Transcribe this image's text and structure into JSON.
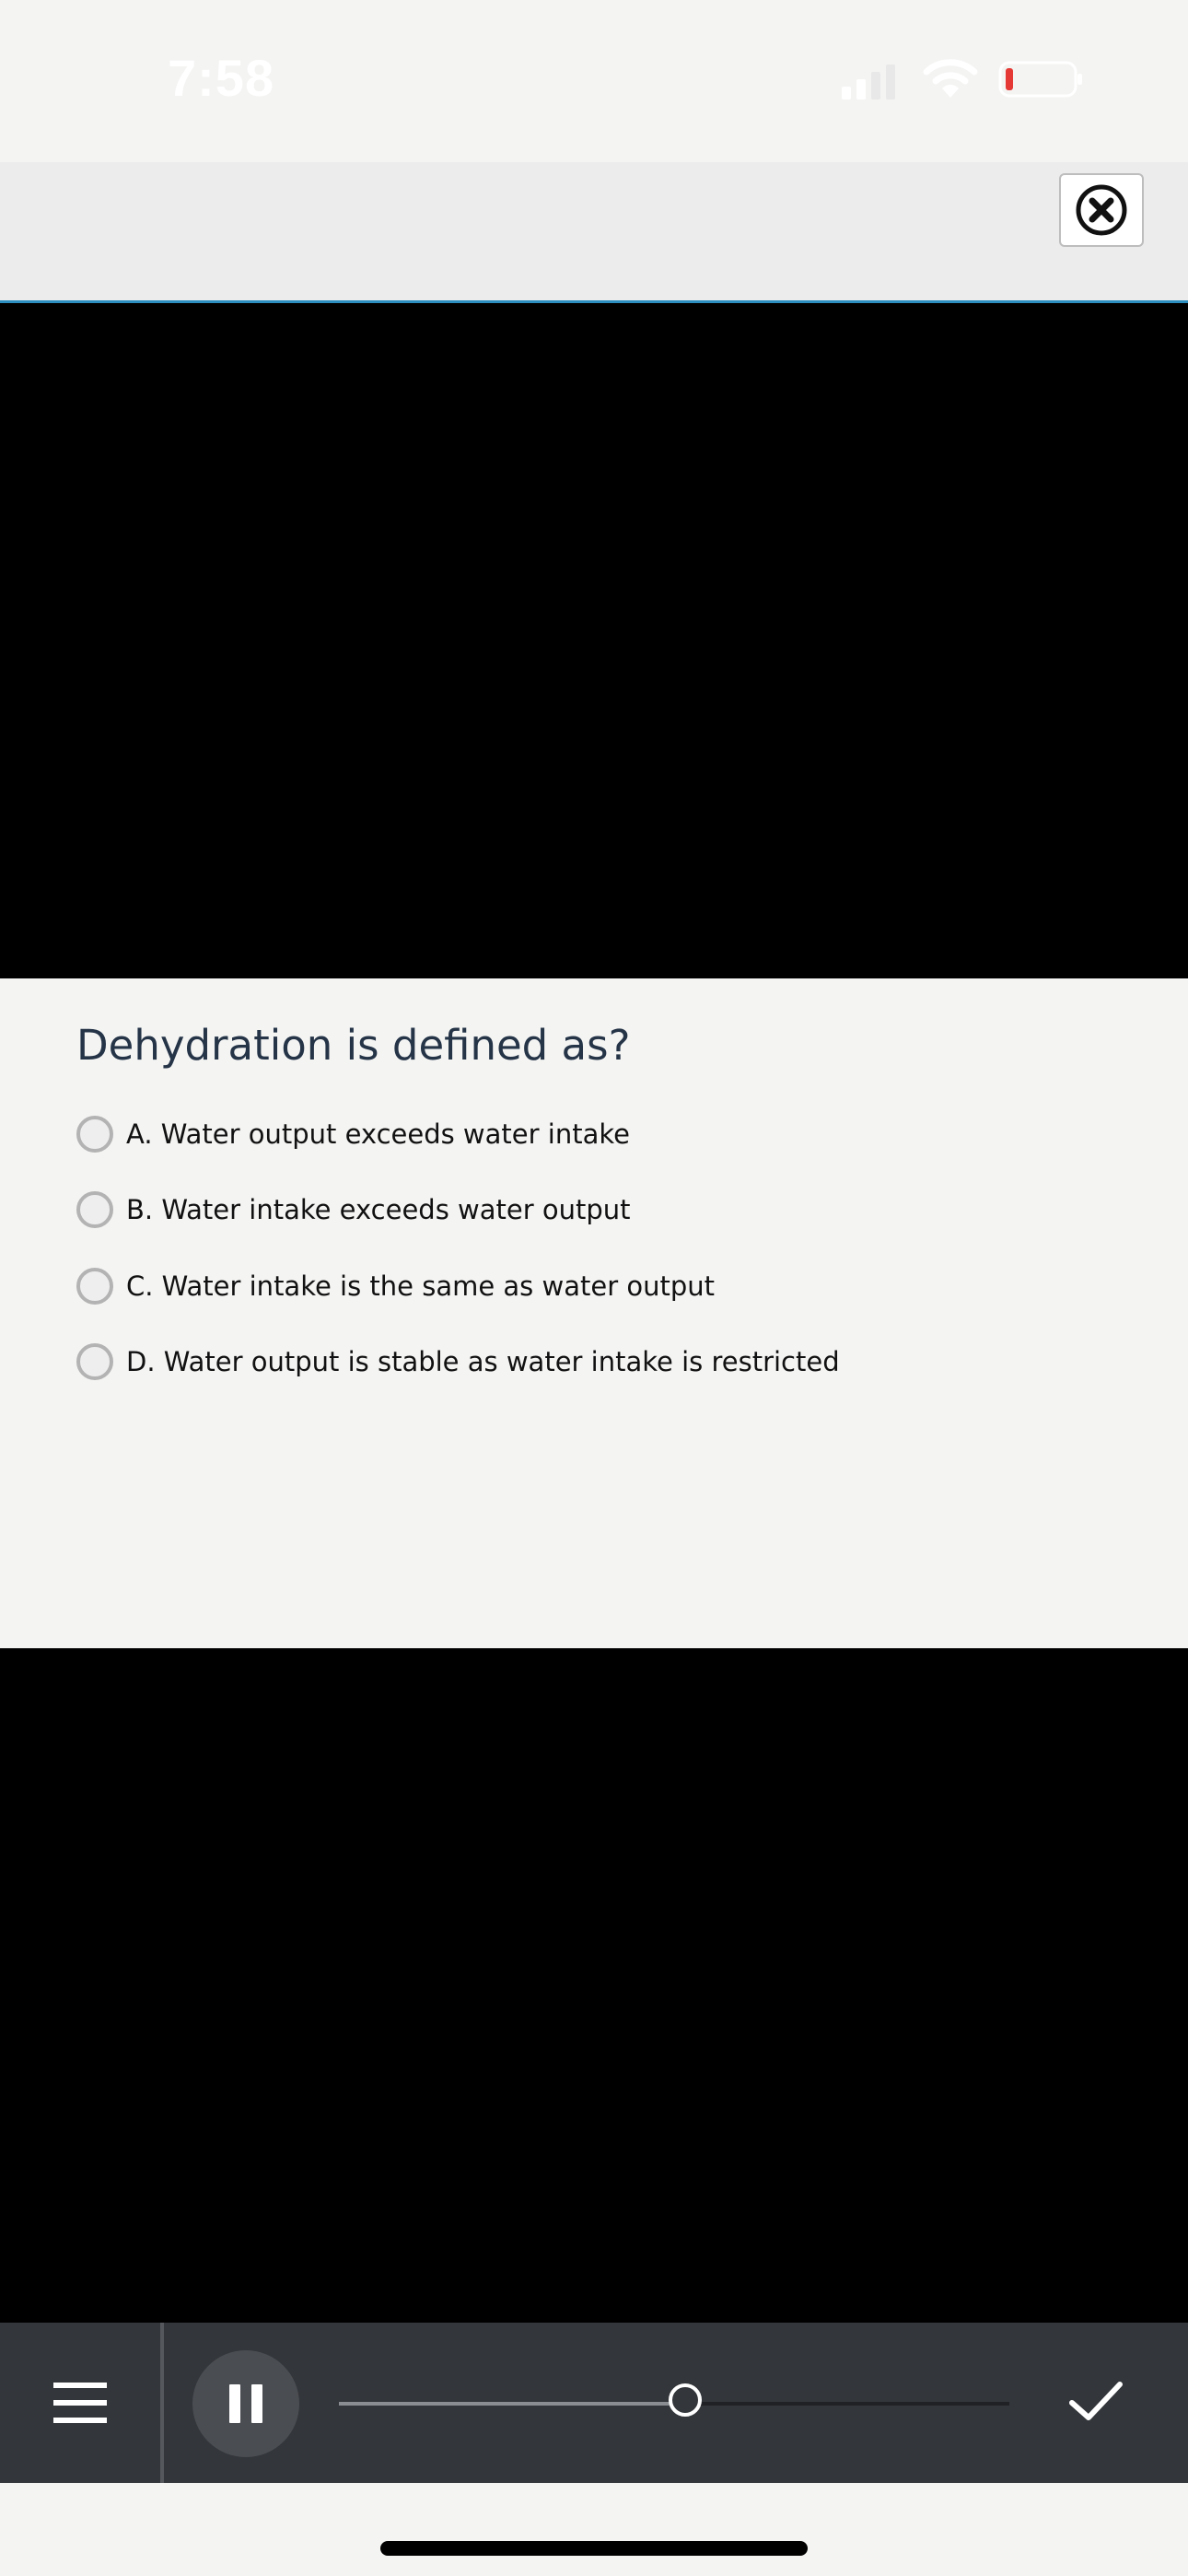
{
  "status_bar": {
    "time": "7:58"
  },
  "quiz": {
    "question": "Dehydration is defined as?",
    "options": [
      "A. Water output exceeds water intake",
      "B. Water intake exceeds water output",
      "C. Water intake is the same as water output",
      "D. Water output is stable as water intake is restricted"
    ]
  },
  "playback": {
    "progress": 0.517
  },
  "icons": {
    "close": "close-circle-icon",
    "menu": "hamburger-menu-icon",
    "pause": "pause-icon",
    "submit": "checkmark-icon"
  },
  "colors": {
    "header_accent": "#2c8ebf",
    "battery_low": "#e53935",
    "question_text": "#253447",
    "playback_bar": "#33363a"
  }
}
